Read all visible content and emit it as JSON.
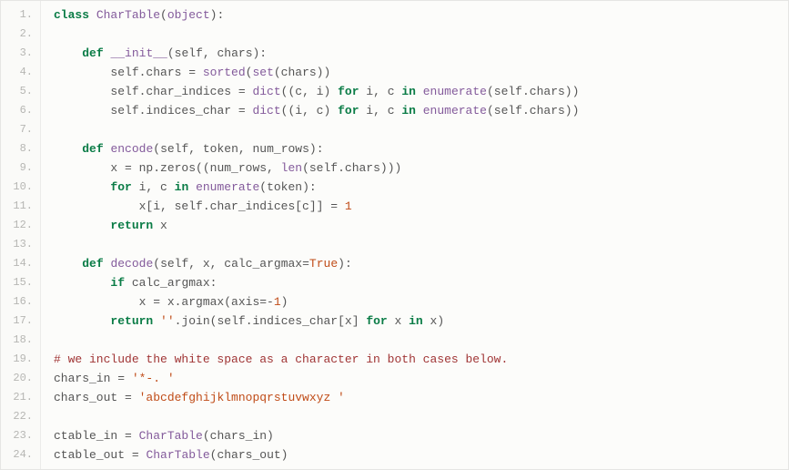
{
  "lines": [
    {
      "n": "1.",
      "tokens": [
        {
          "t": "class ",
          "c": "tk-keyword"
        },
        {
          "t": "CharTable",
          "c": "tk-class"
        },
        {
          "t": "(",
          "c": "tk-paren"
        },
        {
          "t": "object",
          "c": "tk-builtin"
        },
        {
          "t": "):",
          "c": "tk-paren"
        }
      ]
    },
    {
      "n": "2.",
      "tokens": []
    },
    {
      "n": "3.",
      "tokens": [
        {
          "t": "    ",
          "c": ""
        },
        {
          "t": "def ",
          "c": "tk-def"
        },
        {
          "t": "__init__",
          "c": "tk-func"
        },
        {
          "t": "(",
          "c": "tk-paren"
        },
        {
          "t": "self",
          "c": "tk-self"
        },
        {
          "t": ", chars):",
          "c": "tk-paren"
        }
      ]
    },
    {
      "n": "4.",
      "tokens": [
        {
          "t": "        self",
          "c": "tk-self"
        },
        {
          "t": ".chars ",
          "c": "tk-dot"
        },
        {
          "t": "= ",
          "c": "tk-assign"
        },
        {
          "t": "sorted",
          "c": "tk-builtin"
        },
        {
          "t": "(",
          "c": "tk-paren"
        },
        {
          "t": "set",
          "c": "tk-builtin"
        },
        {
          "t": "(chars))",
          "c": "tk-paren"
        }
      ]
    },
    {
      "n": "5.",
      "tokens": [
        {
          "t": "        self",
          "c": "tk-self"
        },
        {
          "t": ".char_indices ",
          "c": "tk-dot"
        },
        {
          "t": "= ",
          "c": "tk-assign"
        },
        {
          "t": "dict",
          "c": "tk-builtin"
        },
        {
          "t": "((c, i) ",
          "c": "tk-paren"
        },
        {
          "t": "for",
          "c": "tk-keyword"
        },
        {
          "t": " i, c ",
          "c": ""
        },
        {
          "t": "in",
          "c": "tk-keyword"
        },
        {
          "t": " ",
          "c": ""
        },
        {
          "t": "enumerate",
          "c": "tk-builtin"
        },
        {
          "t": "(",
          "c": "tk-paren"
        },
        {
          "t": "self",
          "c": "tk-self"
        },
        {
          "t": ".chars))",
          "c": "tk-paren"
        }
      ]
    },
    {
      "n": "6.",
      "tokens": [
        {
          "t": "        self",
          "c": "tk-self"
        },
        {
          "t": ".indices_char ",
          "c": "tk-dot"
        },
        {
          "t": "= ",
          "c": "tk-assign"
        },
        {
          "t": "dict",
          "c": "tk-builtin"
        },
        {
          "t": "((i, c) ",
          "c": "tk-paren"
        },
        {
          "t": "for",
          "c": "tk-keyword"
        },
        {
          "t": " i, c ",
          "c": ""
        },
        {
          "t": "in",
          "c": "tk-keyword"
        },
        {
          "t": " ",
          "c": ""
        },
        {
          "t": "enumerate",
          "c": "tk-builtin"
        },
        {
          "t": "(",
          "c": "tk-paren"
        },
        {
          "t": "self",
          "c": "tk-self"
        },
        {
          "t": ".chars))",
          "c": "tk-paren"
        }
      ]
    },
    {
      "n": "7.",
      "tokens": []
    },
    {
      "n": "8.",
      "tokens": [
        {
          "t": "    ",
          "c": ""
        },
        {
          "t": "def ",
          "c": "tk-def"
        },
        {
          "t": "encode",
          "c": "tk-func"
        },
        {
          "t": "(",
          "c": "tk-paren"
        },
        {
          "t": "self",
          "c": "tk-self"
        },
        {
          "t": ", token, num_rows):",
          "c": "tk-paren"
        }
      ]
    },
    {
      "n": "9.",
      "tokens": [
        {
          "t": "        x ",
          "c": ""
        },
        {
          "t": "= ",
          "c": "tk-assign"
        },
        {
          "t": "np.zeros((num_rows, ",
          "c": ""
        },
        {
          "t": "len",
          "c": "tk-builtin"
        },
        {
          "t": "(",
          "c": "tk-paren"
        },
        {
          "t": "self",
          "c": "tk-self"
        },
        {
          "t": ".chars)))",
          "c": "tk-paren"
        }
      ]
    },
    {
      "n": "10.",
      "tokens": [
        {
          "t": "        ",
          "c": ""
        },
        {
          "t": "for",
          "c": "tk-keyword"
        },
        {
          "t": " i, c ",
          "c": ""
        },
        {
          "t": "in",
          "c": "tk-keyword"
        },
        {
          "t": " ",
          "c": ""
        },
        {
          "t": "enumerate",
          "c": "tk-builtin"
        },
        {
          "t": "(token):",
          "c": "tk-paren"
        }
      ]
    },
    {
      "n": "11.",
      "tokens": [
        {
          "t": "            x[i, ",
          "c": ""
        },
        {
          "t": "self",
          "c": "tk-self"
        },
        {
          "t": ".char_indices[c]] ",
          "c": ""
        },
        {
          "t": "= ",
          "c": "tk-assign"
        },
        {
          "t": "1",
          "c": "tk-num"
        }
      ]
    },
    {
      "n": "12.",
      "tokens": [
        {
          "t": "        ",
          "c": ""
        },
        {
          "t": "return",
          "c": "tk-keyword"
        },
        {
          "t": " x",
          "c": ""
        }
      ]
    },
    {
      "n": "13.",
      "tokens": []
    },
    {
      "n": "14.",
      "tokens": [
        {
          "t": "    ",
          "c": ""
        },
        {
          "t": "def ",
          "c": "tk-def"
        },
        {
          "t": "decode",
          "c": "tk-func"
        },
        {
          "t": "(",
          "c": "tk-paren"
        },
        {
          "t": "self",
          "c": "tk-self"
        },
        {
          "t": ", x, calc_argmax",
          "c": "tk-paren"
        },
        {
          "t": "=",
          "c": "tk-assign"
        },
        {
          "t": "True",
          "c": "tk-bool"
        },
        {
          "t": "):",
          "c": "tk-paren"
        }
      ]
    },
    {
      "n": "15.",
      "tokens": [
        {
          "t": "        ",
          "c": ""
        },
        {
          "t": "if",
          "c": "tk-keyword"
        },
        {
          "t": " calc_argmax:",
          "c": ""
        }
      ]
    },
    {
      "n": "16.",
      "tokens": [
        {
          "t": "            x ",
          "c": ""
        },
        {
          "t": "= ",
          "c": "tk-assign"
        },
        {
          "t": "x.argmax(axis",
          "c": ""
        },
        {
          "t": "=-",
          "c": "tk-assign"
        },
        {
          "t": "1",
          "c": "tk-num"
        },
        {
          "t": ")",
          "c": "tk-paren"
        }
      ]
    },
    {
      "n": "17.",
      "tokens": [
        {
          "t": "        ",
          "c": ""
        },
        {
          "t": "return",
          "c": "tk-keyword"
        },
        {
          "t": " ",
          "c": ""
        },
        {
          "t": "''",
          "c": "tk-str"
        },
        {
          "t": ".join(",
          "c": ""
        },
        {
          "t": "self",
          "c": "tk-self"
        },
        {
          "t": ".indices_char[x] ",
          "c": ""
        },
        {
          "t": "for",
          "c": "tk-keyword"
        },
        {
          "t": " x ",
          "c": ""
        },
        {
          "t": "in",
          "c": "tk-keyword"
        },
        {
          "t": " x)",
          "c": ""
        }
      ]
    },
    {
      "n": "18.",
      "tokens": []
    },
    {
      "n": "19.",
      "tokens": [
        {
          "t": "# we include the white space as a character in both cases below.",
          "c": "tk-comment"
        }
      ]
    },
    {
      "n": "20.",
      "tokens": [
        {
          "t": "chars_in ",
          "c": ""
        },
        {
          "t": "= ",
          "c": "tk-assign"
        },
        {
          "t": "'*-. '",
          "c": "tk-str"
        }
      ]
    },
    {
      "n": "21.",
      "tokens": [
        {
          "t": "chars_out ",
          "c": ""
        },
        {
          "t": "= ",
          "c": "tk-assign"
        },
        {
          "t": "'abcdefghijklmnopqrstuvwxyz '",
          "c": "tk-str"
        }
      ]
    },
    {
      "n": "22.",
      "tokens": []
    },
    {
      "n": "23.",
      "tokens": [
        {
          "t": "ctable_in ",
          "c": ""
        },
        {
          "t": "= ",
          "c": "tk-assign"
        },
        {
          "t": "CharTable",
          "c": "tk-class"
        },
        {
          "t": "(chars_in)",
          "c": "tk-paren"
        }
      ]
    },
    {
      "n": "24.",
      "tokens": [
        {
          "t": "ctable_out ",
          "c": ""
        },
        {
          "t": "= ",
          "c": "tk-assign"
        },
        {
          "t": "CharTable",
          "c": "tk-class"
        },
        {
          "t": "(chars_out)",
          "c": "tk-paren"
        }
      ]
    }
  ]
}
